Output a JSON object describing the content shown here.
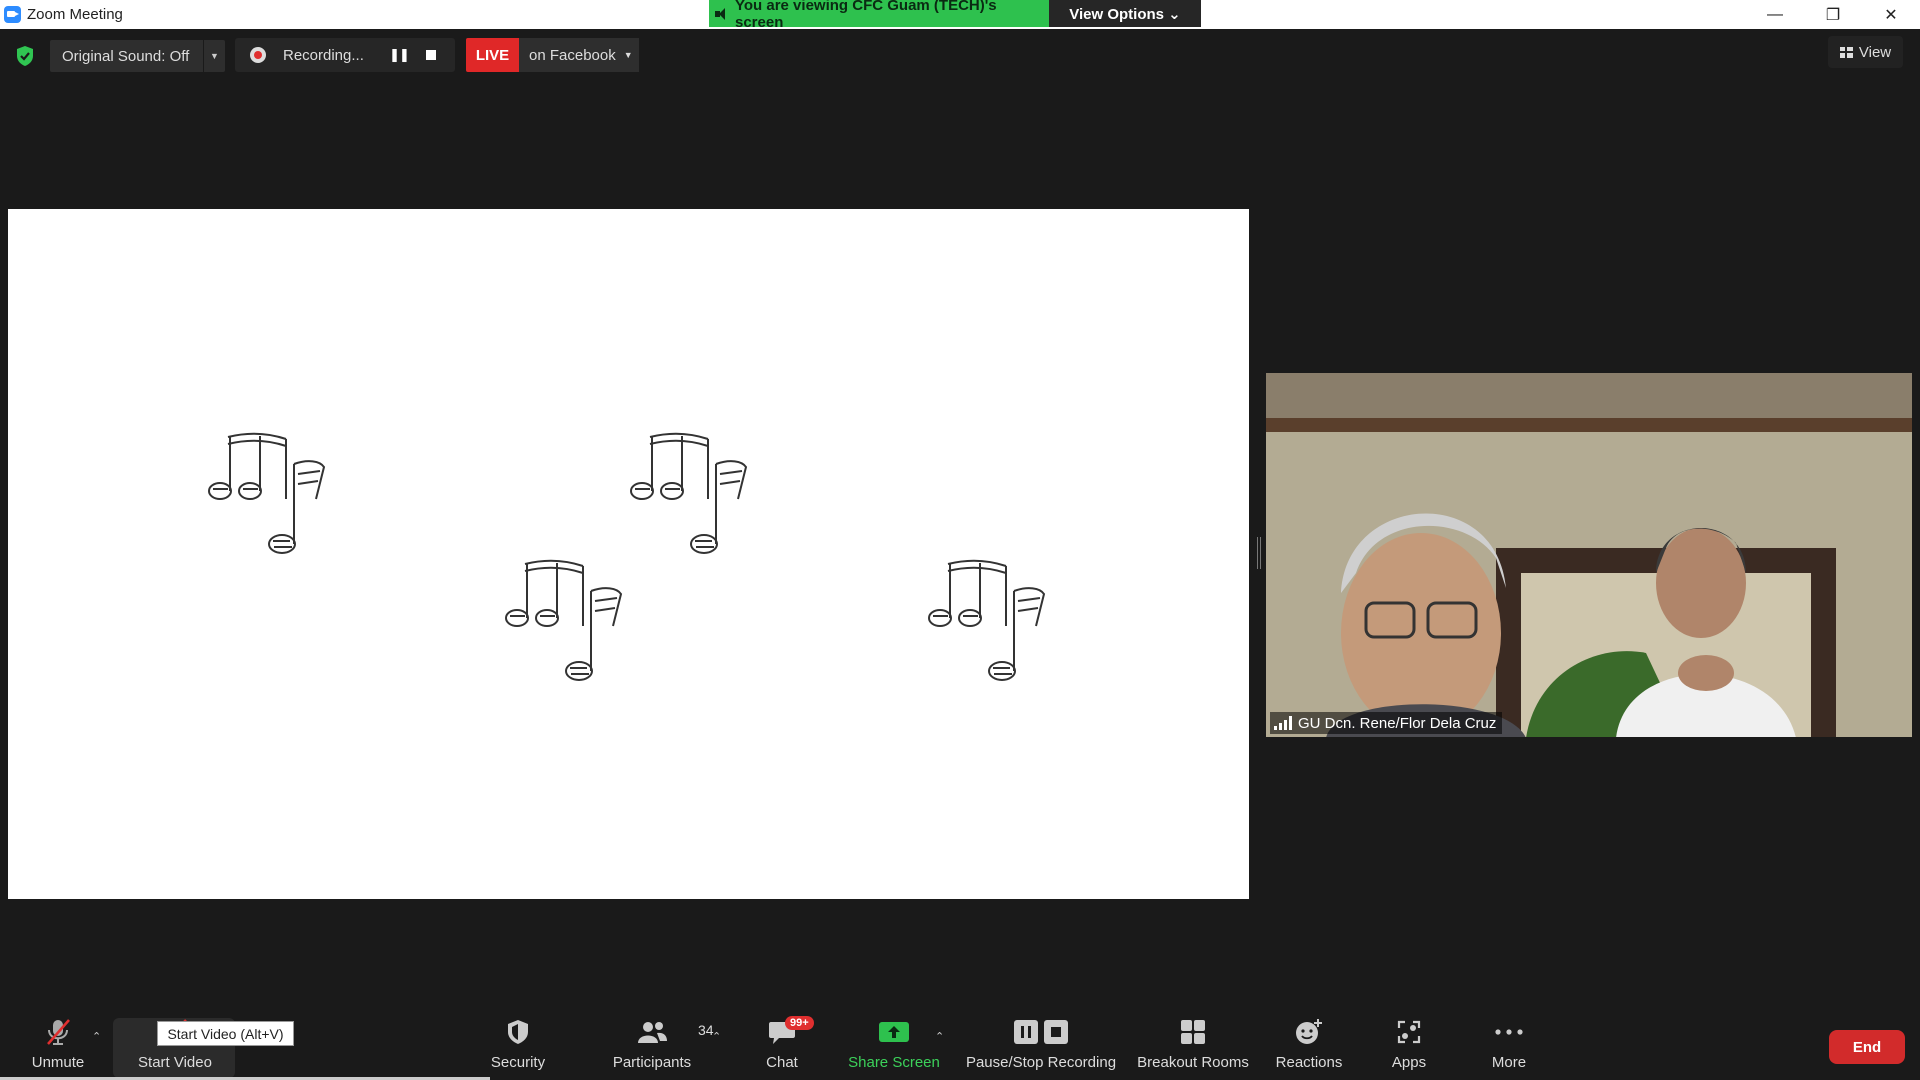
{
  "window": {
    "title": "Zoom Meeting",
    "controls": {
      "minimize": "—",
      "restore": "❐",
      "close": "✕"
    }
  },
  "banner": {
    "viewing_text": "You are viewing CFC Guam (TECH)'s screen",
    "view_options_label": "View Options ⌄"
  },
  "top_toolbar": {
    "original_sound_label": "Original Sound: Off",
    "recording_label": "Recording...",
    "live_badge": "LIVE",
    "live_destination": "on Facebook",
    "view_label": "View"
  },
  "video": {
    "participant_name": "GU Dcn. Rene/Flor Dela Cruz"
  },
  "bottom_toolbar": {
    "unmute": "Unmute",
    "start_video": "Start Video",
    "tooltip": "Start Video (Alt+V)",
    "security": "Security",
    "participants": "Participants",
    "participants_count": "34",
    "chat": "Chat",
    "chat_badge": "99+",
    "share_screen": "Share Screen",
    "pause_stop_recording": "Pause/Stop Recording",
    "breakout_rooms": "Breakout Rooms",
    "reactions": "Reactions",
    "apps": "Apps",
    "more": "More",
    "end": "End"
  },
  "colors": {
    "accent_green": "#2ec14e",
    "live_red": "#e02828",
    "end_red": "#d22b2b",
    "zoom_blue": "#2d8cff"
  }
}
